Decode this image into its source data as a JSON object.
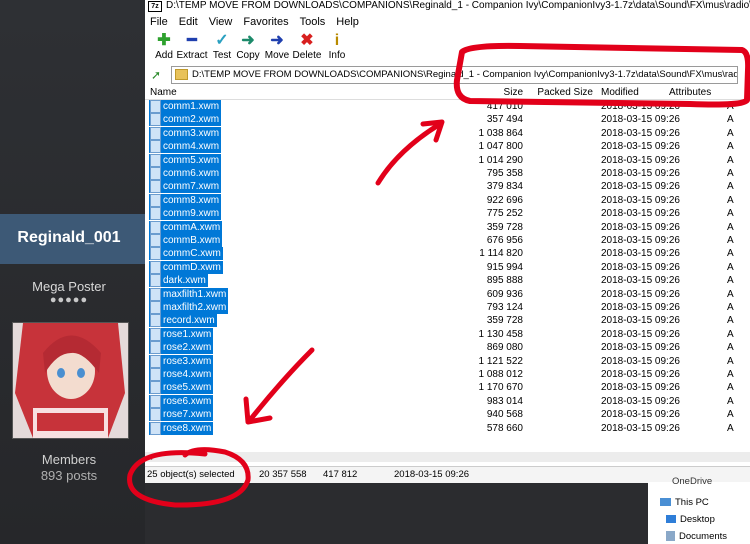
{
  "forum": {
    "username": "Reginald_001",
    "rank": "Mega Poster",
    "rank_dots": "●●●●●",
    "group": "Members",
    "posts": "893 posts"
  },
  "window": {
    "title": "D:\\TEMP MOVE FROM DOWNLOADS\\COMPANIONS\\Reginald_1 - Companion Ivy\\CompanionIvy3-1.7z\\data\\Sound\\FX\\mus\\radio\\ivyradio\\",
    "menu": [
      "File",
      "Edit",
      "View",
      "Favorites",
      "Tools",
      "Help"
    ],
    "toolbar": [
      {
        "label": "Add",
        "icon": "add-icon",
        "glyph": "✚",
        "color": "#2ea12e"
      },
      {
        "label": "Extract",
        "icon": "extract-icon",
        "glyph": "━",
        "color": "#1f3fae"
      },
      {
        "label": "Test",
        "icon": "test-icon",
        "glyph": "✓",
        "color": "#2aa0c0"
      },
      {
        "label": "Copy",
        "icon": "copy-icon",
        "glyph": "➜",
        "color": "#1c8a6a"
      },
      {
        "label": "Move",
        "icon": "move-icon",
        "glyph": "➜",
        "color": "#1f3fae"
      },
      {
        "label": "Delete",
        "icon": "delete-icon",
        "glyph": "✖",
        "color": "#d8201f"
      },
      {
        "label": "Info",
        "icon": "info-icon",
        "glyph": "i",
        "color": "#b88a00"
      }
    ],
    "address": "D:\\TEMP MOVE FROM DOWNLOADS\\COMPANIONS\\Reginald_1 - Companion Ivy\\CompanionIvy3-1.7z\\data\\Sound\\FX\\mus\\radio\\ivyradio\\",
    "columns": {
      "name": "Name",
      "size": "Size",
      "packed": "Packed Size",
      "modified": "Modified",
      "attributes": "Attributes"
    },
    "files": [
      {
        "name": "comm1.xwm",
        "size": "417 010",
        "modified": "2018-03-15 09:26",
        "attr": "A"
      },
      {
        "name": "comm2.xwm",
        "size": "357 494",
        "modified": "2018-03-15 09:26",
        "attr": "A"
      },
      {
        "name": "comm3.xwm",
        "size": "1 038 864",
        "modified": "2018-03-15 09:26",
        "attr": "A"
      },
      {
        "name": "comm4.xwm",
        "size": "1 047 800",
        "modified": "2018-03-15 09:26",
        "attr": "A"
      },
      {
        "name": "comm5.xwm",
        "size": "1 014 290",
        "modified": "2018-03-15 09:26",
        "attr": "A"
      },
      {
        "name": "comm6.xwm",
        "size": "795 358",
        "modified": "2018-03-15 09:26",
        "attr": "A"
      },
      {
        "name": "comm7.xwm",
        "size": "379 834",
        "modified": "2018-03-15 09:26",
        "attr": "A"
      },
      {
        "name": "comm8.xwm",
        "size": "922 696",
        "modified": "2018-03-15 09:26",
        "attr": "A"
      },
      {
        "name": "comm9.xwm",
        "size": "775 252",
        "modified": "2018-03-15 09:26",
        "attr": "A"
      },
      {
        "name": "commA.xwm",
        "size": "359 728",
        "modified": "2018-03-15 09:26",
        "attr": "A"
      },
      {
        "name": "commB.xwm",
        "size": "676 956",
        "modified": "2018-03-15 09:26",
        "attr": "A"
      },
      {
        "name": "commC.xwm",
        "size": "1 114 820",
        "modified": "2018-03-15 09:26",
        "attr": "A"
      },
      {
        "name": "commD.xwm",
        "size": "915 994",
        "modified": "2018-03-15 09:26",
        "attr": "A"
      },
      {
        "name": "dark.xwm",
        "size": "895 888",
        "modified": "2018-03-15 09:26",
        "attr": "A"
      },
      {
        "name": "maxfilth1.xwm",
        "size": "609 936",
        "modified": "2018-03-15 09:26",
        "attr": "A"
      },
      {
        "name": "maxfilth2.xwm",
        "size": "793 124",
        "modified": "2018-03-15 09:26",
        "attr": "A"
      },
      {
        "name": "record.xwm",
        "size": "359 728",
        "modified": "2018-03-15 09:26",
        "attr": "A"
      },
      {
        "name": "rose1.xwm",
        "size": "1 130 458",
        "modified": "2018-03-15 09:26",
        "attr": "A"
      },
      {
        "name": "rose2.xwm",
        "size": "869 080",
        "modified": "2018-03-15 09:26",
        "attr": "A"
      },
      {
        "name": "rose3.xwm",
        "size": "1 121 522",
        "modified": "2018-03-15 09:26",
        "attr": "A"
      },
      {
        "name": "rose4.xwm",
        "size": "1 088 012",
        "modified": "2018-03-15 09:26",
        "attr": "A"
      },
      {
        "name": "rose5.xwm",
        "size": "1 170 670",
        "modified": "2018-03-15 09:26",
        "attr": "A"
      },
      {
        "name": "rose6.xwm",
        "size": "983 014",
        "modified": "2018-03-15 09:26",
        "attr": "A"
      },
      {
        "name": "rose7.xwm",
        "size": "940 568",
        "modified": "2018-03-15 09:26",
        "attr": "A"
      },
      {
        "name": "rose8.xwm",
        "size": "578 660",
        "modified": "2018-03-15 09:26",
        "attr": "A"
      }
    ],
    "status": {
      "selected": "25 object(s) selected",
      "total_size": "20 357 558",
      "packed_size": "417 812",
      "modified": "2018-03-15 09:26"
    }
  },
  "explorer": {
    "items": [
      "OneDrive",
      "This PC",
      "Desktop",
      "Documents"
    ]
  },
  "colors": {
    "selection": "#0078d7",
    "annotation": "#e2001a",
    "forum_band": "#3d5976"
  }
}
